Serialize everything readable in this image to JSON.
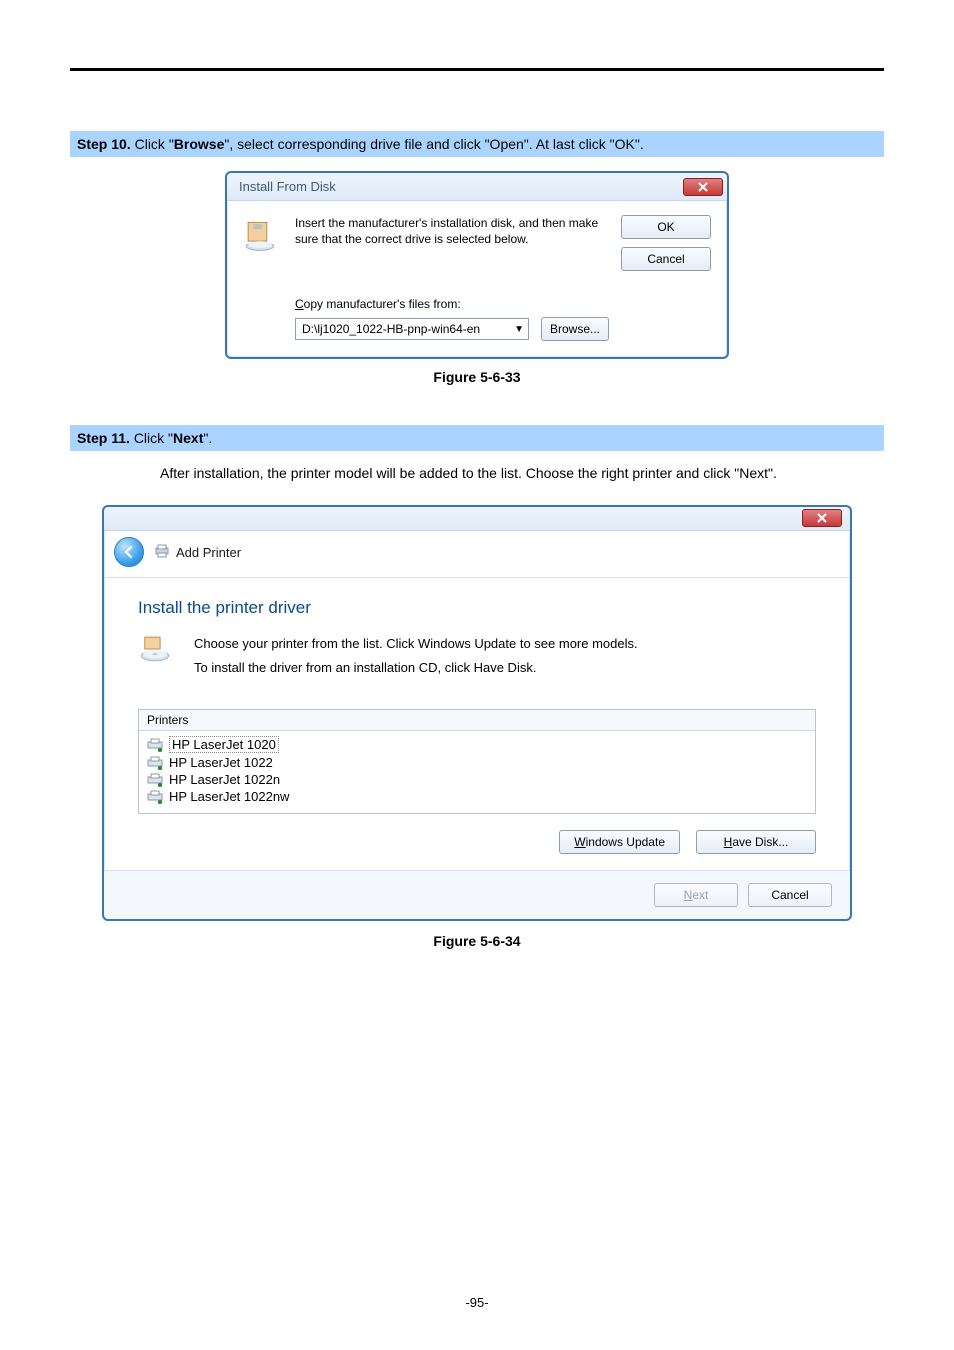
{
  "step10": {
    "label": "Step 10.",
    "text_before": "Click \"",
    "bold": "Browse",
    "text_after": "\", select corresponding drive file and click \"Open\". At last click \"OK\"."
  },
  "dlg1": {
    "title": "Install From Disk",
    "instruction": "Insert the manufacturer's installation disk, and then make sure that the correct drive is selected below.",
    "ok": "OK",
    "cancel": "Cancel",
    "copy_label_pre_u": "C",
    "copy_label_rest": "opy manufacturer's files from:",
    "path": "D:\\lj1020_1022-HB-pnp-win64-en",
    "browse_pre_u": "B",
    "browse_rest": "rowse..."
  },
  "figure33": "Figure 5-6-33",
  "step11": {
    "label": "Step 11.",
    "text_before": "Click \"",
    "bold": "Next",
    "text_after": "\"."
  },
  "after_install": "After installation, the printer model will be added to the list. Choose the right printer and click \"Next\".",
  "dlg2": {
    "title": "Add Printer",
    "heading": "Install the printer driver",
    "msg1": "Choose your printer from the list. Click Windows Update to see more models.",
    "msg2": "To install the driver from an installation CD, click Have Disk.",
    "printers_header": "Printers",
    "printers": [
      "HP LaserJet 1020",
      "HP LaserJet 1022",
      "HP LaserJet 1022n",
      "HP LaserJet 1022nw"
    ],
    "windows_update_u": "W",
    "windows_update_rest": "indows Update",
    "have_disk_u": "H",
    "have_disk_rest": "ave Disk...",
    "next_u": "N",
    "next_rest": "ext",
    "cancel": "Cancel"
  },
  "figure34": "Figure 5-6-34",
  "page_num": "-95-"
}
